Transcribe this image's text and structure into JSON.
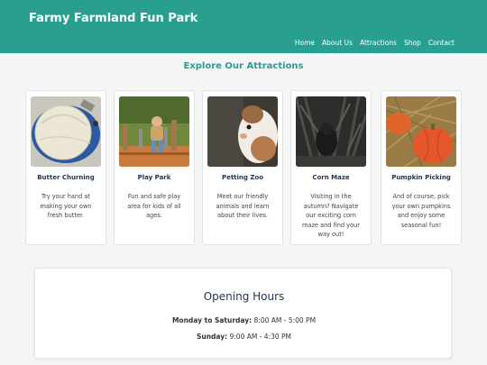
{
  "header": {
    "title": "Farmy Farmland Fun Park",
    "nav": [
      "Home",
      "About Us",
      "Attractions",
      "Shop",
      "Contact"
    ]
  },
  "attractions": {
    "heading": "Explore Our Attractions",
    "items": [
      {
        "name": "Butter Churning",
        "desc": "Try your hand at making your own fresh butter.",
        "icon": "butter-photo"
      },
      {
        "name": "Play Park",
        "desc": "Fun and safe play area for kids of all ages.",
        "icon": "playground-photo"
      },
      {
        "name": "Petting Zoo",
        "desc": "Meet our friendly animals and learn about their lives.",
        "icon": "guinea-pig-photo"
      },
      {
        "name": "Corn Maze",
        "desc": "Visiting in the autumn? Navigate our exciting corn maze and find your way out!",
        "icon": "corn-maze-photo"
      },
      {
        "name": "Pumpkin Picking",
        "desc": "And of course, pick your own pumpkins and enjoy some seasonal fun!",
        "icon": "pumpkin-photo"
      }
    ]
  },
  "hours": {
    "title": "Opening Hours",
    "weekday_label": "Monday to Saturday:",
    "weekday_value": " 8:00 AM - 5:00 PM",
    "sunday_label": "Sunday:",
    "sunday_value": " 9:00 AM - 4:30 PM"
  },
  "colors": {
    "header": "#299f8f",
    "accent": "#2a9d8f",
    "heading": "#1f3550"
  }
}
